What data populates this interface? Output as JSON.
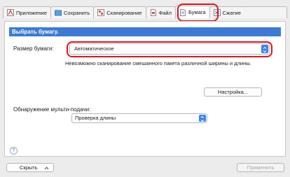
{
  "tabs": [
    {
      "label": "Приложение",
      "icon": "application-icon"
    },
    {
      "label": "Сохранить",
      "icon": "save-folder-icon"
    },
    {
      "label": "Сканирование",
      "icon": "scan-icon"
    },
    {
      "label": "Файл",
      "icon": "file-icon"
    },
    {
      "label": "Бумага",
      "icon": "paper-icon",
      "active": true
    },
    {
      "label": "Сжатие",
      "icon": "compression-icon"
    }
  ],
  "panel": {
    "header": "Выбрать бумагу.",
    "paper_size_label": "Размер бумаги:",
    "paper_size_value": "Автоматическое",
    "paper_size_note": "Невозможно сканирование смешанного пакета различной ширины и длины.",
    "settings_button": "Настройка...",
    "multifeed_label": "Обнаружение мульти-подачи:",
    "multifeed_value": "Проверка длины",
    "help": "?"
  },
  "bottom": {
    "hide_button": "Скрыть",
    "apply_button": "Применить"
  },
  "colors": {
    "header_bg": "#3b7bd6",
    "highlight": "#e0141e",
    "stepper": "#3a82f0"
  }
}
